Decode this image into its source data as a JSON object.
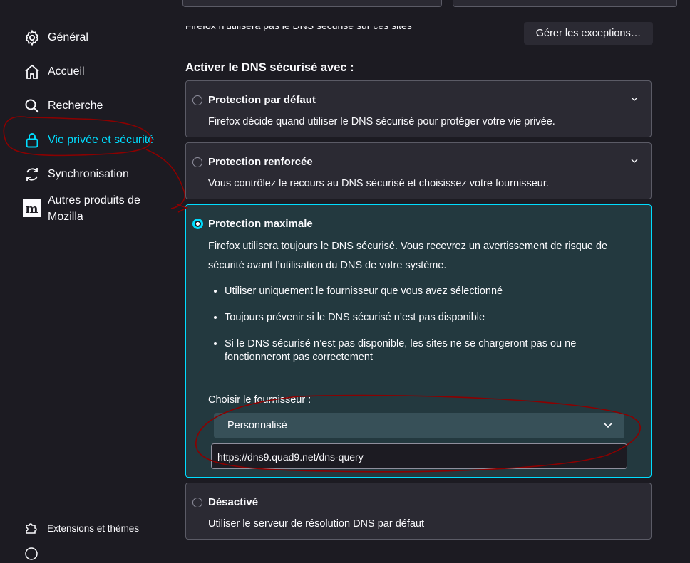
{
  "sidebar": {
    "items": [
      {
        "label": "Général",
        "icon": "gear-icon"
      },
      {
        "label": "Accueil",
        "icon": "home-icon"
      },
      {
        "label": "Recherche",
        "icon": "search-icon"
      },
      {
        "label": "Vie privée et sécurité",
        "icon": "lock-icon",
        "active": true
      },
      {
        "label": "Synchronisation",
        "icon": "sync-icon"
      },
      {
        "label": "Autres produits de Mozilla",
        "icon": "mozilla-icon"
      }
    ],
    "footer": [
      {
        "label": "Extensions et thèmes",
        "icon": "puzzle-icon"
      }
    ]
  },
  "main": {
    "cut_text": "Firefox n'utilisera pas le DNS sécurisé sur ces sites",
    "exceptions_button": "Gérer les exceptions…",
    "heading": "Activer le DNS sécurisé avec :",
    "options": [
      {
        "title": "Protection par défaut",
        "desc": "Firefox décide quand utiliser le DNS sécurisé pour protéger votre vie privée."
      },
      {
        "title": "Protection renforcée",
        "desc": "Vous contrôlez le recours au DNS sécurisé et choisissez votre fournisseur."
      },
      {
        "title": "Protection maximale",
        "desc": "Firefox utilisera toujours le DNS sécurisé. Vous recevrez un avertissement de risque de sécurité avant l’utilisation du DNS de votre système.",
        "bullets": [
          "Utiliser uniquement le fournisseur que vous avez sélectionné",
          "Toujours prévenir si le DNS sécurisé n’est pas disponible",
          "Si le DNS sécurisé n’est pas disponible, les sites ne se chargeront pas ou ne fonctionneront pas correctement"
        ],
        "provider_label": "Choisir le fournisseur :",
        "provider_value": "Personnalisé",
        "custom_url": "https://dns9.quad9.net/dns-query"
      },
      {
        "title": "Désactivé",
        "desc": "Utiliser le serveur de résolution DNS par défaut"
      }
    ]
  },
  "colors": {
    "accent": "#00ddff",
    "annotation": "#8b0000",
    "background": "#1c1b22",
    "card": "#2b2a33",
    "selected_card": "#23393f"
  }
}
